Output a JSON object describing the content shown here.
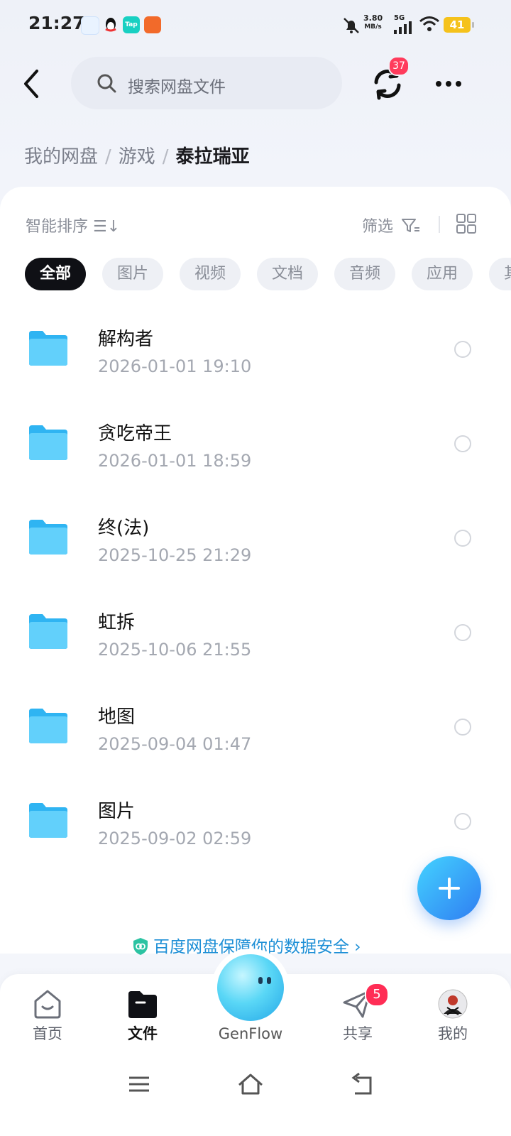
{
  "status_bar": {
    "time": "21:27",
    "speed_value": "3.80",
    "speed_unit": "MB/s",
    "network": "5G",
    "battery": "41",
    "apps": [
      "baidu-netdisk-icon",
      "qq-icon",
      "taptap-icon",
      "tool-app-icon"
    ]
  },
  "header": {
    "search_placeholder": "搜索网盘文件",
    "sync_badge": "37"
  },
  "breadcrumb": {
    "items": [
      "我的网盘",
      "游戏"
    ],
    "separator": "/",
    "current": "泰拉瑞亚"
  },
  "toolbar": {
    "sort_label": "智能排序 ☰↓",
    "filter_label": "筛选"
  },
  "chips": [
    "全部",
    "图片",
    "视频",
    "文档",
    "音频",
    "应用",
    "其他"
  ],
  "files": [
    {
      "name": "解构者",
      "date": "2026-01-01  19:10"
    },
    {
      "name": "贪吃帝王",
      "date": "2026-01-01  18:59"
    },
    {
      "name": "终(法)",
      "date": "2025-10-25  21:29"
    },
    {
      "name": "虹拆",
      "date": "2025-10-06  21:55"
    },
    {
      "name": "地图",
      "date": "2025-09-04  01:47"
    },
    {
      "name": "图片",
      "date": "2025-09-02  02:59"
    }
  ],
  "security_banner": "百度网盘保障你的数据安全 ›",
  "bottom_nav": {
    "home": "首页",
    "files": "文件",
    "genflow": "GenFlow",
    "share": "共享",
    "share_badge": "5",
    "mine": "我的"
  },
  "colors": {
    "accent": "#2f7df2",
    "folder": "#4cc4f7",
    "badge": "#ff3b5c",
    "active_chip": "#0f1015"
  }
}
